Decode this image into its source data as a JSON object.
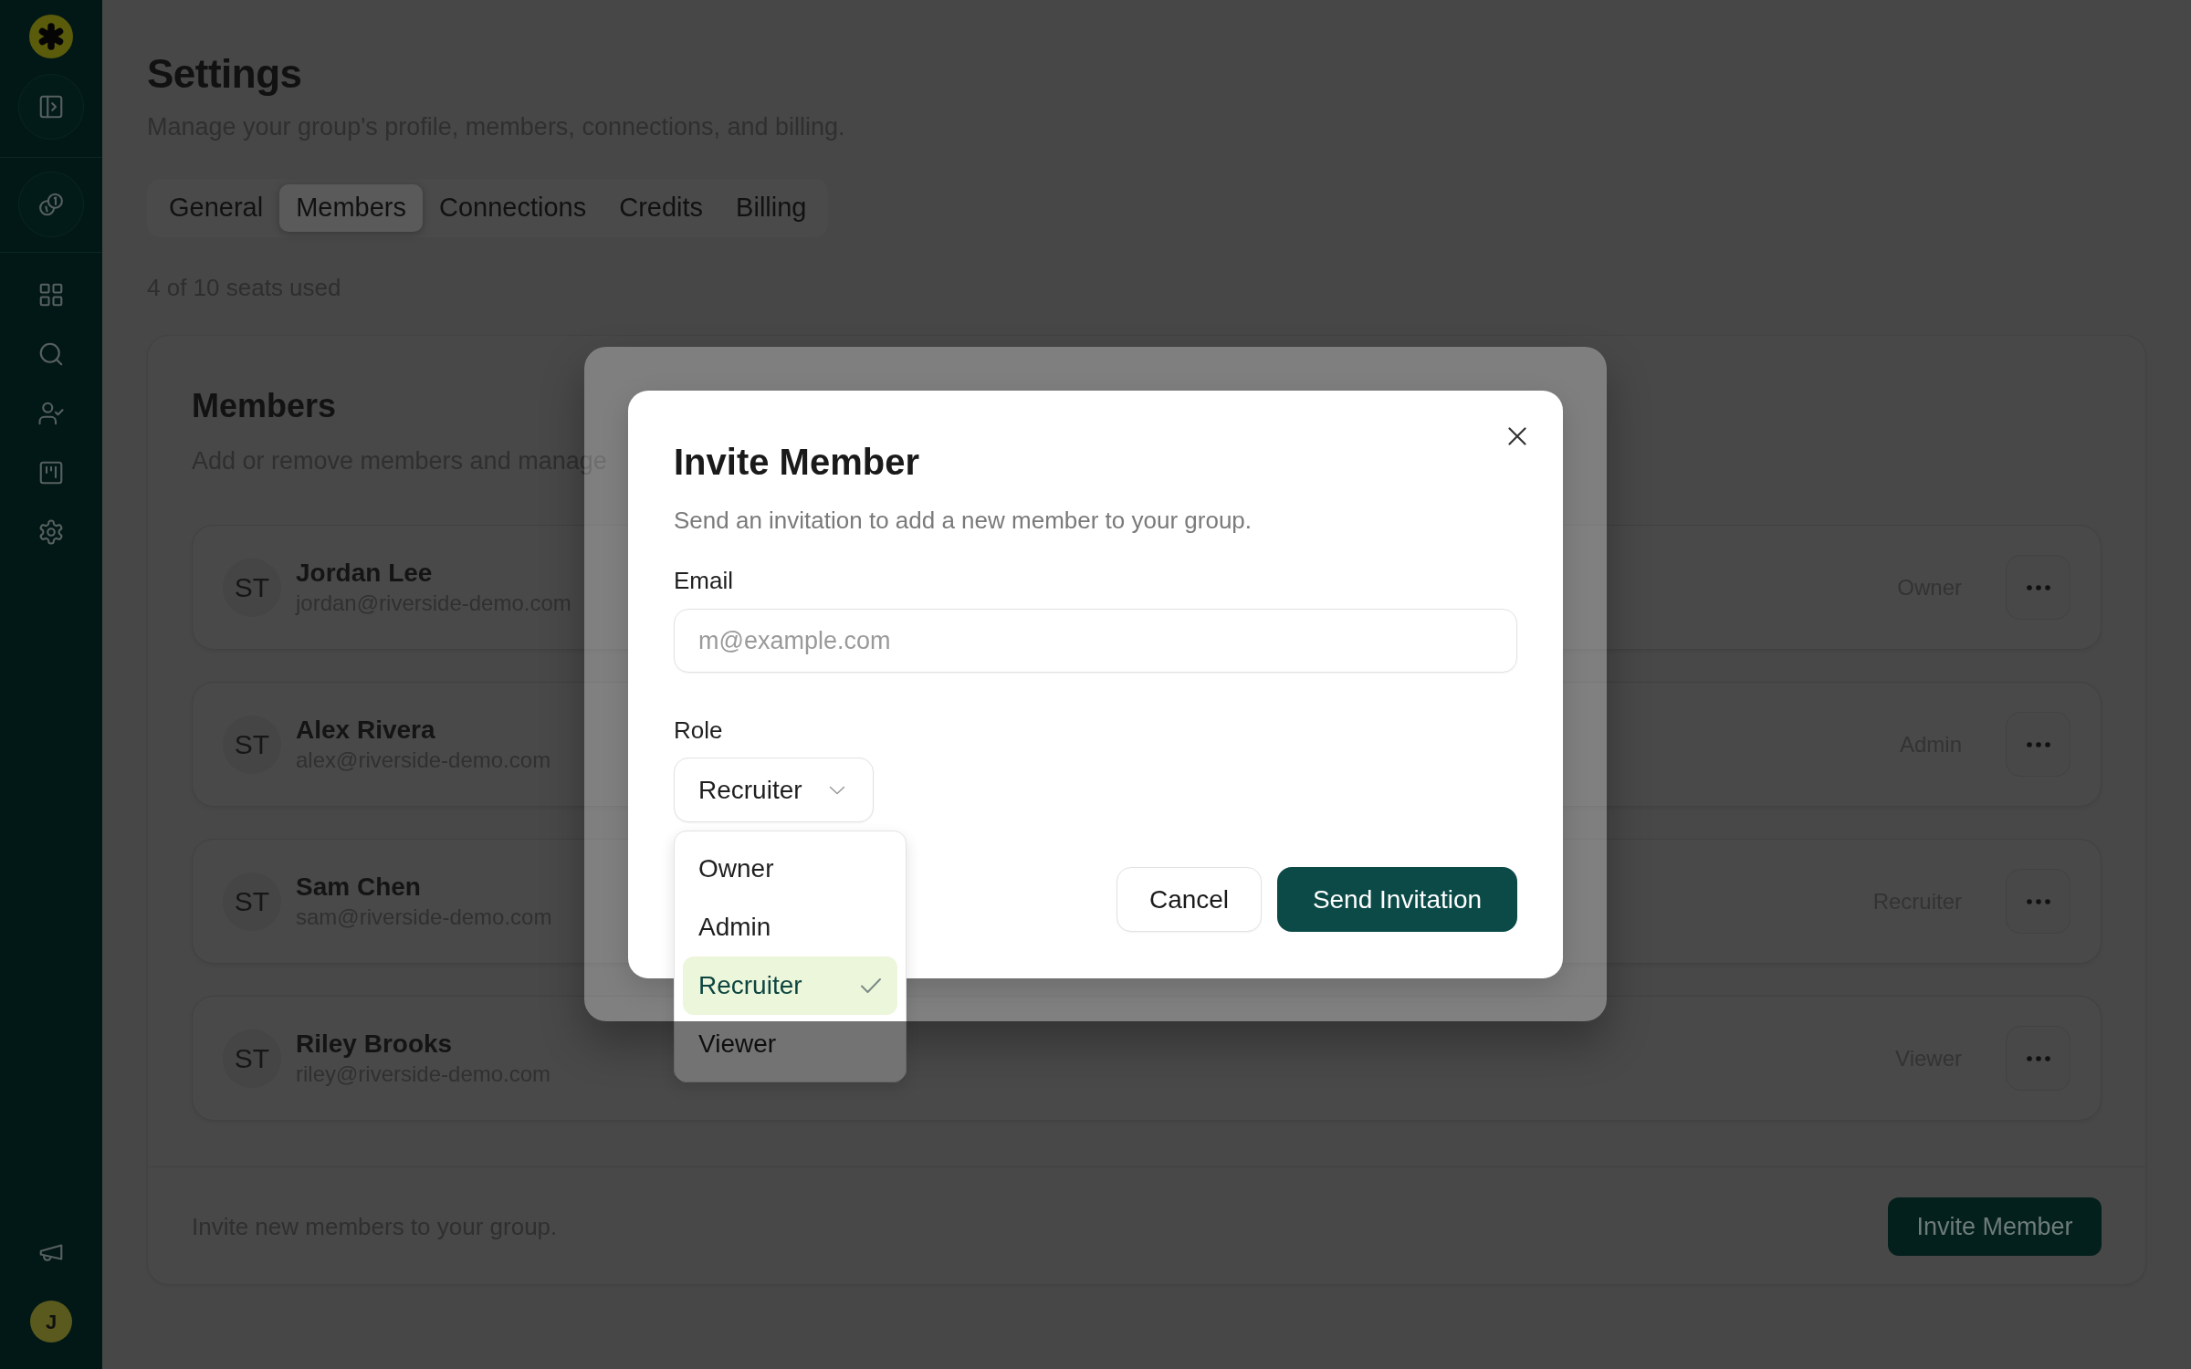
{
  "sidebar": {
    "avatar": "J"
  },
  "page": {
    "title": "Settings",
    "subtitle": "Manage your group's profile, members, connections, and billing.",
    "tabs": [
      {
        "label": "General",
        "selected": false
      },
      {
        "label": "Members",
        "selected": true
      },
      {
        "label": "Connections",
        "selected": false
      },
      {
        "label": "Credits",
        "selected": false
      },
      {
        "label": "Billing",
        "selected": false
      }
    ],
    "seats": "4 of 10 seats used"
  },
  "members_card": {
    "title": "Members",
    "description": "Add or remove members and manage",
    "members": [
      {
        "initials": "ST",
        "name": "Jordan Lee",
        "email": "jordan@riverside-demo.com",
        "role": "Owner"
      },
      {
        "initials": "ST",
        "name": "Alex Rivera",
        "email": "alex@riverside-demo.com",
        "role": "Admin"
      },
      {
        "initials": "ST",
        "name": "Sam Chen",
        "email": "sam@riverside-demo.com",
        "role": "Recruiter"
      },
      {
        "initials": "ST",
        "name": "Riley Brooks",
        "email": "riley@riverside-demo.com",
        "role": "Viewer"
      }
    ],
    "footer_text": "Invite new members to your group.",
    "invite_button": "Invite Member"
  },
  "dialog": {
    "title": "Invite Member",
    "description": "Send an invitation to add a new member to your group.",
    "email": {
      "label": "Email",
      "placeholder": "m@example.com"
    },
    "role": {
      "label": "Role",
      "value": "Recruiter",
      "expanded": true,
      "options": [
        {
          "label": "Owner",
          "selected": false
        },
        {
          "label": "Admin",
          "selected": false
        },
        {
          "label": "Recruiter",
          "selected": true
        },
        {
          "label": "Viewer",
          "selected": false
        }
      ]
    },
    "buttons": [
      {
        "kind": "cancel",
        "label": "Cancel"
      },
      {
        "kind": "submit",
        "label": "Send Invitation"
      }
    ]
  }
}
